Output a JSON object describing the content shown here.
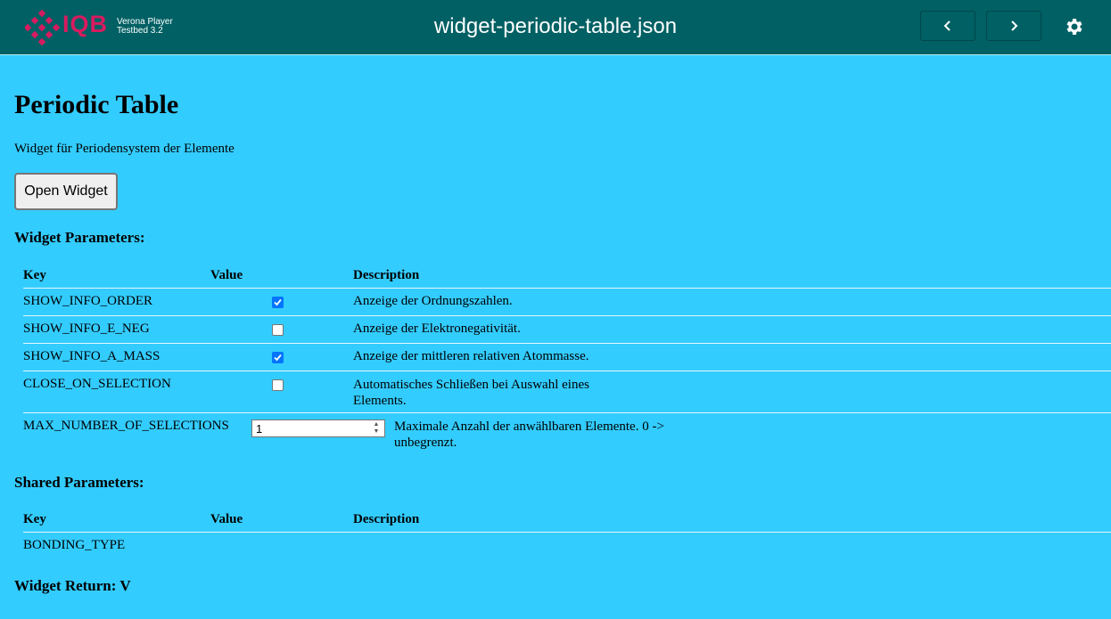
{
  "header": {
    "logo_text": "IQB",
    "brand_line1": "Verona Player",
    "brand_line2": "Testbed 3.2",
    "file_title": "widget-periodic-table.json",
    "prev_icon": "chevron-left-icon",
    "next_icon": "chevron-right-icon",
    "settings_icon": "gear-icon"
  },
  "main": {
    "title": "Periodic Table",
    "description": "Widget für Periodensystem der Elemente",
    "open_button": "Open Widget",
    "widget_params_heading": "Widget Parameters:",
    "shared_params_heading": "Shared Parameters:",
    "widget_return": "Widget Return: V"
  },
  "table_headers": {
    "key": "Key",
    "value": "Value",
    "description": "Description"
  },
  "widget_params": [
    {
      "key": "SHOW_INFO_ORDER",
      "checked": true,
      "description": "Anzeige der Ordnungszahlen."
    },
    {
      "key": "SHOW_INFO_E_NEG",
      "checked": false,
      "description": "Anzeige der Elektronegativität."
    },
    {
      "key": "SHOW_INFO_A_MASS",
      "checked": true,
      "description": "Anzeige der mittleren relativen Atommasse."
    },
    {
      "key": "CLOSE_ON_SELECTION",
      "checked": false,
      "description_line1": "Automatisches Schließen bei Auswahl eines",
      "description_line2": "Elements."
    },
    {
      "key": "MAX_NUMBER_OF_SELECTIONS",
      "value": "1",
      "description_line1": "Maximale Anzahl der anwählbaren Elemente. 0 ->",
      "description_line2": "unbegrenzt."
    }
  ],
  "shared_params": [
    {
      "key": "BONDING_TYPE"
    }
  ],
  "colors": {
    "header_bg": "#006064",
    "page_bg": "#33ccff",
    "logo": "#d81b60",
    "checkbox": "#0075ff"
  }
}
